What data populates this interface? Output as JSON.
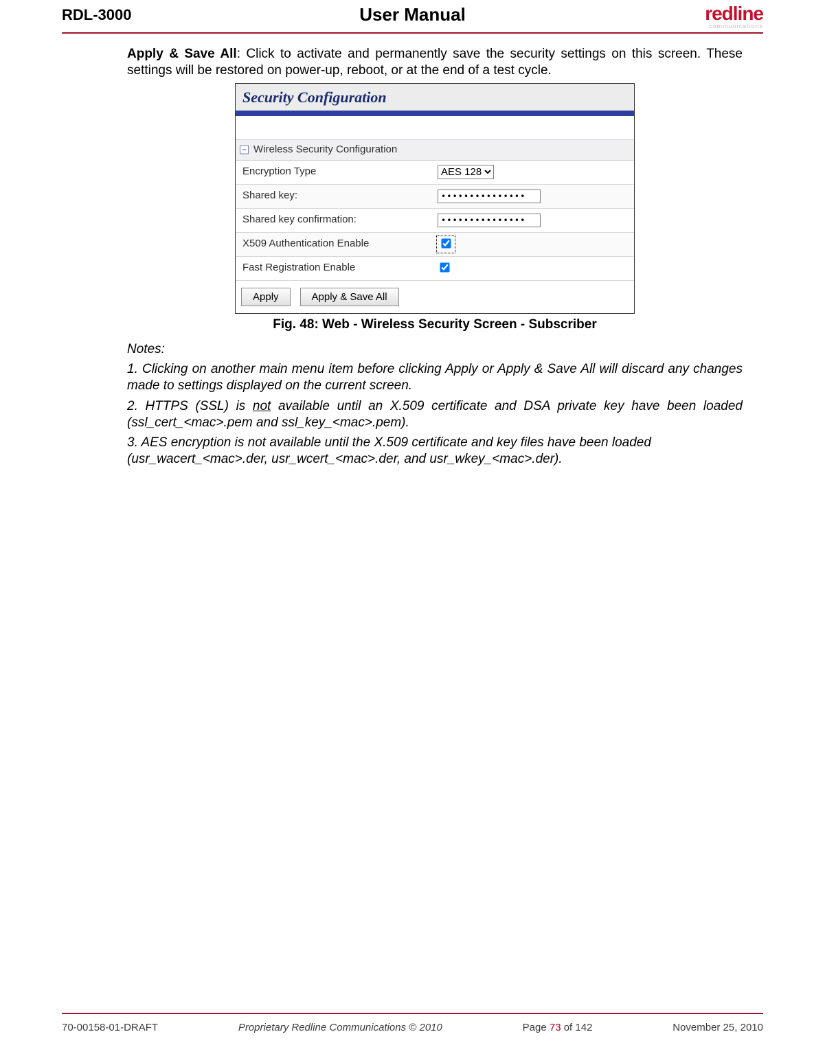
{
  "header": {
    "left": "RDL-3000",
    "center": "User Manual",
    "logo_main": "redline",
    "logo_sub": "communications"
  },
  "intro": {
    "bold": "Apply & Save All",
    "rest": ": Click to activate and permanently save the security settings on this screen. These settings will be restored on power-up, reboot, or at the end of a test cycle."
  },
  "screenshot": {
    "title": "Security Configuration",
    "section_head": "Wireless Security Configuration",
    "collapse_glyph": "−",
    "rows": {
      "encryption_label": "Encryption Type",
      "encryption_value": "AES 128",
      "shared_key_label": "Shared key:",
      "shared_key_value": "•••••••••••••••",
      "shared_key_conf_label": "Shared key confirmation:",
      "shared_key_conf_value": "•••••••••••••••",
      "x509_label": "X509 Authentication Enable",
      "fastreg_label": "Fast Registration Enable"
    },
    "buttons": {
      "apply": "Apply",
      "apply_save": "Apply & Save All"
    }
  },
  "figure_caption_prefix": "Fig. 48",
  "figure_caption_rest": ": Web - Wireless Security Screen - Subscriber",
  "notes_heading": "Notes:",
  "note1": "1. Clicking on another main menu item before clicking Apply or Apply & Save All will discard any changes made to settings displayed on the current screen.",
  "note2_pre": "2. HTTPS (SSL) is ",
  "note2_not": "not",
  "note2_post": " available until an X.509 certificate and DSA private key have been loaded (ssl_cert_<mac>.pem and ssl_key_<mac>.pem).",
  "note3": "3. AES encryption is not available until the X.509 certificate and key files have been loaded (usr_wacert_<mac>.der, usr_wcert_<mac>.der, and usr_wkey_<mac>.der).",
  "footer": {
    "docnum": "70-00158-01-DRAFT",
    "copyright": "Proprietary Redline Communications © 2010",
    "page_pre": "Page ",
    "page_cur": "73",
    "page_mid": " of ",
    "page_total": "142",
    "date": "November 25, 2010"
  }
}
